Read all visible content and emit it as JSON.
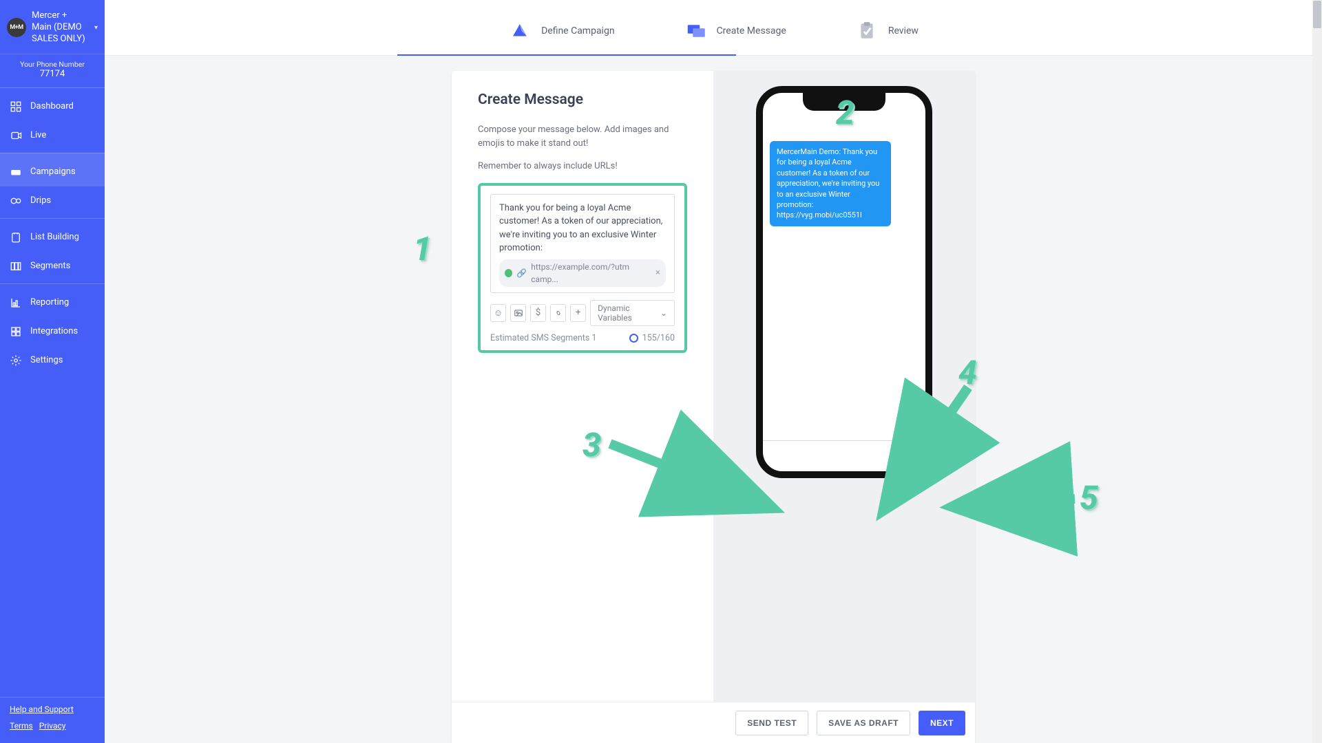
{
  "org": {
    "avatar": "M+M",
    "name": "Mercer + Main (DEMO SALES ONLY)"
  },
  "phone": {
    "label": "Your Phone Number",
    "number": "77174"
  },
  "nav": {
    "dashboard": "Dashboard",
    "live": "Live",
    "campaigns": "Campaigns",
    "drips": "Drips",
    "list_building": "List Building",
    "segments": "Segments",
    "reporting": "Reporting",
    "integrations": "Integrations",
    "settings": "Settings"
  },
  "footer_links": {
    "help": "Help and Support",
    "terms": "Terms",
    "privacy": "Privacy"
  },
  "stepper": {
    "define": "Define Campaign",
    "create": "Create Message",
    "review": "Review"
  },
  "editor": {
    "heading": "Create Message",
    "intro": "Compose your message below. Add images and emojis to make it stand out!",
    "reminder": "Remember to always include URLs!",
    "message_text": "Thank you for being a loyal Acme customer! As a token of our appreciation, we're inviting you to an exclusive Winter promotion:",
    "url_chip": "https://example.com/?utm camp...",
    "dynamic_vars": "Dynamic Variables",
    "segments_label": "Estimated SMS Segments 1",
    "char_count": "155/160"
  },
  "preview": {
    "bubble": "MercerMain Demo: Thank you for being a loyal Acme customer! As a token of our appreciation, we're inviting you to an exclusive Winter promotion:  https://vyg.mobi/uc0551l"
  },
  "buttons": {
    "send_test": "SEND TEST",
    "save_draft": "SAVE AS DRAFT",
    "next": "NEXT"
  },
  "annotations": {
    "n1": "1",
    "n2": "2",
    "n3": "3",
    "n4": "4",
    "n5": "5"
  }
}
